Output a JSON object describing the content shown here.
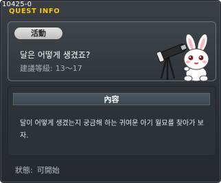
{
  "window": {
    "quest_id": "10425-0",
    "title": "QUEST INFO"
  },
  "quest": {
    "category": "活動",
    "name": "달은 어떻게 생겼죠?",
    "level_label": "建議等級:",
    "level_range": "13～17"
  },
  "content": {
    "header": "內容",
    "description": "달이 어떻게 생겼는지 궁금해 하는 귀여운 아기 월묘를 찾아가 보자."
  },
  "status": {
    "label": "狀態:",
    "value": "可開始"
  },
  "icons": {
    "mascot": "moon-bunny-telescope-icon"
  },
  "colors": {
    "title": "#f2c81c",
    "panel_bg": "#2d3237",
    "window_bg": "#2b2f34"
  }
}
